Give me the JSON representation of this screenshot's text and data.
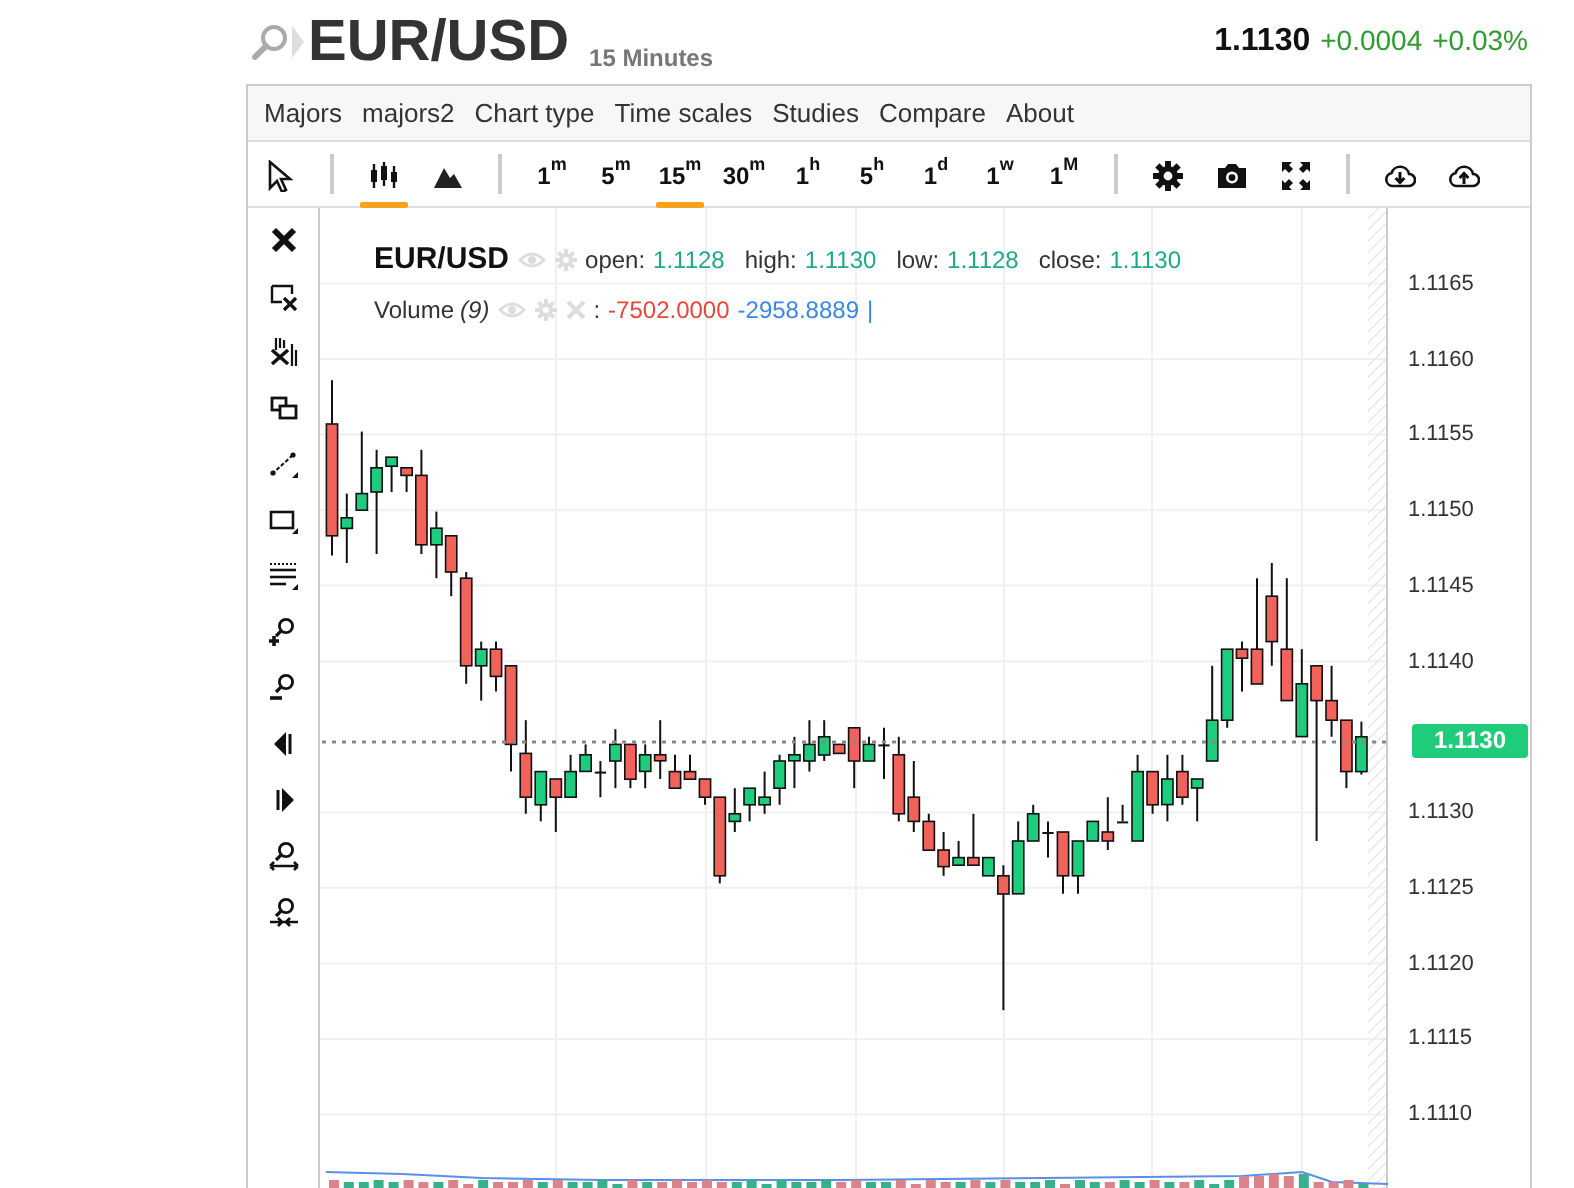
{
  "header": {
    "title": "EUR/USD",
    "subtitle": "15 Minutes",
    "price": "1.1130",
    "change": "+0.0004",
    "change_percent": "+0.03%"
  },
  "menu": [
    "Majors",
    "majors2",
    "Chart type",
    "Time scales",
    "Studies",
    "Compare",
    "About"
  ],
  "toolbar": {
    "chart_types": [
      {
        "kind": "candles",
        "selected": true
      },
      {
        "kind": "mountain",
        "selected": false
      }
    ],
    "time_scales": [
      {
        "label": "1$^{m}$",
        "selected": false
      },
      {
        "label": "5$^{m}$",
        "selected": false
      },
      {
        "label": "15$^{m}$",
        "selected": true
      },
      {
        "label": "30$^{m}$",
        "selected": false
      },
      {
        "label": "1$^{h}$",
        "selected": false
      },
      {
        "label": "5$^{h}$",
        "selected": false
      },
      {
        "label": "1$^{d}$",
        "selected": false
      },
      {
        "label": "1$^{w}$",
        "selected": false
      },
      {
        "label": "1$^{M}$",
        "selected": false
      }
    ]
  },
  "legend": {
    "symbol": "EUR/USD",
    "fields": [
      {
        "label": "open:",
        "value": "1.1128"
      },
      {
        "label": "high:",
        "value": "1.1130"
      },
      {
        "label": "low:",
        "value": "1.1128"
      },
      {
        "label": "close:",
        "value": "1.1130"
      }
    ],
    "study": {
      "name": "Volume",
      "param": "(9)",
      "separator": ":",
      "values": [
        {
          "text": "-7502.0000",
          "color": "#e8453c"
        },
        {
          "text": "-2958.8889",
          "color": "#3b87e8"
        }
      ],
      "cursor": "|"
    }
  },
  "chart": {
    "current_price": "1.1130",
    "chart_data": {
      "type": "candlestick",
      "categories": [
        null,
        null,
        null,
        null,
        null,
        null,
        null,
        null,
        null,
        null,
        null,
        null,
        null,
        null,
        null,
        null,
        null,
        null,
        null,
        null,
        null,
        null,
        null,
        null,
        null,
        null,
        null,
        null,
        null,
        null,
        null,
        null,
        null,
        null,
        null,
        null,
        null,
        null,
        null,
        null,
        null,
        null,
        null,
        null,
        null,
        null,
        null,
        null,
        null,
        null,
        null,
        null,
        null,
        null,
        null,
        null,
        null,
        null,
        null,
        null,
        null,
        null,
        null,
        null,
        null,
        null,
        null,
        null,
        null,
        null
      ],
      "ylim": [
        1.1105,
        1.117
      ],
      "grid": true,
      "yticks": [
        {
          "value": 1.1165,
          "label": "1.1165"
        },
        {
          "value": 1.116,
          "label": "1.1160"
        },
        {
          "value": 1.1155,
          "label": "1.1155"
        },
        {
          "value": 1.115,
          "label": "1.1150"
        },
        {
          "value": 1.1145,
          "label": "1.1145"
        },
        {
          "value": 1.114,
          "label": "1.1140"
        },
        {
          "value": 1.113,
          "label": "1.1130"
        },
        {
          "value": 1.1125,
          "label": "1.1125"
        },
        {
          "value": 1.112,
          "label": "1.1120"
        },
        {
          "value": 1.1115,
          "label": "1.1115"
        },
        {
          "value": 1.111,
          "label": "1.1110"
        }
      ],
      "ohlc": [
        [
          1.11557,
          1.11586,
          1.1147,
          1.11483
        ],
        [
          1.11488,
          1.11511,
          1.11465,
          1.11495
        ],
        [
          1.115,
          1.11552,
          1.115,
          1.11511
        ],
        [
          1.11512,
          1.1154,
          1.11471,
          1.11528
        ],
        [
          1.11529,
          1.11535,
          1.11512,
          1.11535
        ],
        [
          1.11528,
          1.11528,
          1.11512,
          1.11523
        ],
        [
          1.11523,
          1.1154,
          1.11471,
          1.11477
        ],
        [
          1.11477,
          1.11499,
          1.11455,
          1.11488
        ],
        [
          1.11483,
          1.11483,
          1.11443,
          1.11459
        ],
        [
          1.11455,
          1.11459,
          1.11385,
          1.11397
        ],
        [
          1.11397,
          1.11413,
          1.11374,
          1.11408
        ],
        [
          1.11408,
          1.11413,
          1.1138,
          1.1139
        ],
        [
          1.11397,
          1.11397,
          1.11327,
          1.11345
        ],
        [
          1.11339,
          1.11361,
          1.11299,
          1.1131
        ],
        [
          1.11305,
          1.11327,
          1.11294,
          1.11327
        ],
        [
          1.11322,
          1.11322,
          1.11287,
          1.1131
        ],
        [
          1.1131,
          1.11338,
          1.1131,
          1.11327
        ],
        [
          1.11327,
          1.11345,
          1.11327,
          1.11338
        ],
        [
          1.11327,
          1.11334,
          1.1131,
          1.11327
        ],
        [
          1.11334,
          1.11355,
          1.11316,
          1.11345
        ],
        [
          1.11345,
          1.11345,
          1.11316,
          1.11322
        ],
        [
          1.11327,
          1.11345,
          1.11316,
          1.11338
        ],
        [
          1.11338,
          1.11361,
          1.11322,
          1.11334
        ],
        [
          1.11327,
          1.11338,
          1.11316,
          1.11316
        ],
        [
          1.11327,
          1.11338,
          1.11322,
          1.11322
        ],
        [
          1.11322,
          1.11322,
          1.11305,
          1.1131
        ],
        [
          1.1131,
          1.1131,
          1.11253,
          1.11258
        ],
        [
          1.11294,
          1.11316,
          1.11287,
          1.11299
        ],
        [
          1.11305,
          1.11316,
          1.11294,
          1.11316
        ],
        [
          1.11305,
          1.11327,
          1.11299,
          1.1131
        ],
        [
          1.11316,
          1.11338,
          1.11305,
          1.11334
        ],
        [
          1.11334,
          1.1135,
          1.11316,
          1.11338
        ],
        [
          1.11334,
          1.11361,
          1.11327,
          1.11345
        ],
        [
          1.11338,
          1.11361,
          1.11334,
          1.1135
        ],
        [
          1.11345,
          1.11345,
          1.11339,
          1.11339
        ],
        [
          1.11356,
          1.11356,
          1.11316,
          1.11334
        ],
        [
          1.11334,
          1.1135,
          1.11334,
          1.11345
        ],
        [
          1.11345,
          1.11356,
          1.11322,
          1.11345
        ],
        [
          1.11338,
          1.1135,
          1.11294,
          1.11299
        ],
        [
          1.1131,
          1.11334,
          1.11287,
          1.11294
        ],
        [
          1.11294,
          1.11299,
          1.11275,
          1.11275
        ],
        [
          1.11275,
          1.11287,
          1.11258,
          1.11264
        ],
        [
          1.11265,
          1.11281,
          1.11265,
          1.1127
        ],
        [
          1.1127,
          1.11299,
          1.11265,
          1.11265
        ],
        [
          1.11258,
          1.1127,
          1.11258,
          1.1127
        ],
        [
          1.11258,
          1.11265,
          1.11169,
          1.11246
        ],
        [
          1.11246,
          1.11294,
          1.11246,
          1.11281
        ],
        [
          1.11281,
          1.11305,
          1.11281,
          1.11299
        ],
        [
          1.11287,
          1.11294,
          1.1127,
          1.11287
        ],
        [
          1.11287,
          1.11287,
          1.11246,
          1.11258
        ],
        [
          1.11258,
          1.11281,
          1.11246,
          1.11281
        ],
        [
          1.11281,
          1.11294,
          1.11281,
          1.11294
        ],
        [
          1.11287,
          1.1131,
          1.11275,
          1.11281
        ],
        [
          1.11294,
          1.11305,
          1.11294,
          1.11294
        ],
        [
          1.11281,
          1.11338,
          1.11281,
          1.11327
        ],
        [
          1.11327,
          1.11327,
          1.11299,
          1.11305
        ],
        [
          1.11305,
          1.11338,
          1.11294,
          1.11322
        ],
        [
          1.11327,
          1.11338,
          1.11305,
          1.1131
        ],
        [
          1.11316,
          1.11322,
          1.11294,
          1.11322
        ],
        [
          1.11334,
          1.11397,
          1.11334,
          1.11361
        ],
        [
          1.11361,
          1.11408,
          1.11356,
          1.11408
        ],
        [
          1.11408,
          1.11413,
          1.1138,
          1.11402
        ],
        [
          1.11408,
          1.11455,
          1.11385,
          1.11385
        ],
        [
          1.11443,
          1.11465,
          1.11397,
          1.11413
        ],
        [
          1.11408,
          1.11455,
          1.11374,
          1.11374
        ],
        [
          1.1135,
          1.11408,
          1.1135,
          1.11385
        ],
        [
          1.11397,
          1.11397,
          1.11281,
          1.11374
        ],
        [
          1.11374,
          1.11397,
          1.1135,
          1.11361
        ],
        [
          1.11361,
          1.11361,
          1.11316,
          1.11327
        ],
        [
          1.11327,
          1.1136,
          1.11325,
          1.1135
        ]
      ]
    }
  }
}
